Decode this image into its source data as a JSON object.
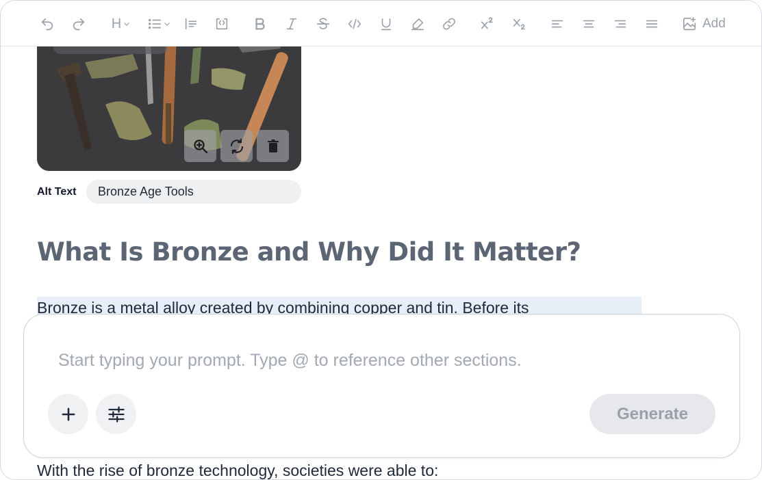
{
  "toolbar": {
    "heading_glyph": "H",
    "add_label": "Add",
    "icons": [
      "undo-icon",
      "redo-icon",
      "heading-icon",
      "list-icon",
      "blockquote-icon",
      "code-block-icon",
      "bold-icon",
      "italic-icon",
      "strikethrough-icon",
      "code-icon",
      "underline-icon",
      "highlight-icon",
      "link-icon",
      "superscript-icon",
      "subscript-icon",
      "align-left-icon",
      "align-center-icon",
      "align-right-icon",
      "align-justify-icon",
      "add-image-icon"
    ]
  },
  "image": {
    "actions": [
      "zoom-in-icon",
      "replace-icon",
      "delete-icon"
    ]
  },
  "alt": {
    "label": "Alt Text",
    "value": "Bronze Age Tools"
  },
  "content": {
    "heading": "What Is Bronze and Why Did It Matter?",
    "paragraph": "Bronze is a metal alloy created by combining copper and tin. Before its",
    "next_line": "With the rise of bronze technology, societies were able to:"
  },
  "prompt": {
    "placeholder": "Start typing your prompt. Type @ to reference other sections.",
    "generate_label": "Generate"
  },
  "colors": {
    "heading": "#5b6573",
    "highlight": "#e7eef7",
    "toolbar_icon": "#9aa1ab"
  }
}
